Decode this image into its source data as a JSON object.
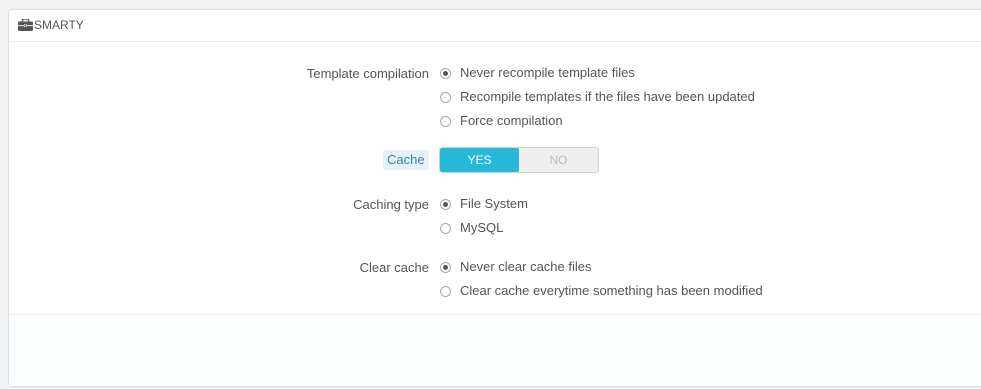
{
  "panel": {
    "title": "SMARTY",
    "icon": "briefcase-icon"
  },
  "template_compilation": {
    "label": "Template compilation",
    "options": [
      {
        "label": "Never recompile template files",
        "checked": true
      },
      {
        "label": "Recompile templates if the files have been updated",
        "checked": false
      },
      {
        "label": "Force compilation",
        "checked": false
      }
    ]
  },
  "cache": {
    "label": "Cache",
    "yes_label": "YES",
    "no_label": "NO",
    "value": "YES"
  },
  "caching_type": {
    "label": "Caching type",
    "options": [
      {
        "label": "File System",
        "checked": true
      },
      {
        "label": "MySQL",
        "checked": false
      }
    ]
  },
  "clear_cache": {
    "label": "Clear cache",
    "options": [
      {
        "label": "Never clear cache files",
        "checked": true
      },
      {
        "label": "Clear cache everytime something has been modified",
        "checked": false
      }
    ]
  },
  "colors": {
    "accent": "#25b9d7",
    "label_highlight": "#3586ae",
    "label_highlight_bg": "#e4f1f7"
  }
}
